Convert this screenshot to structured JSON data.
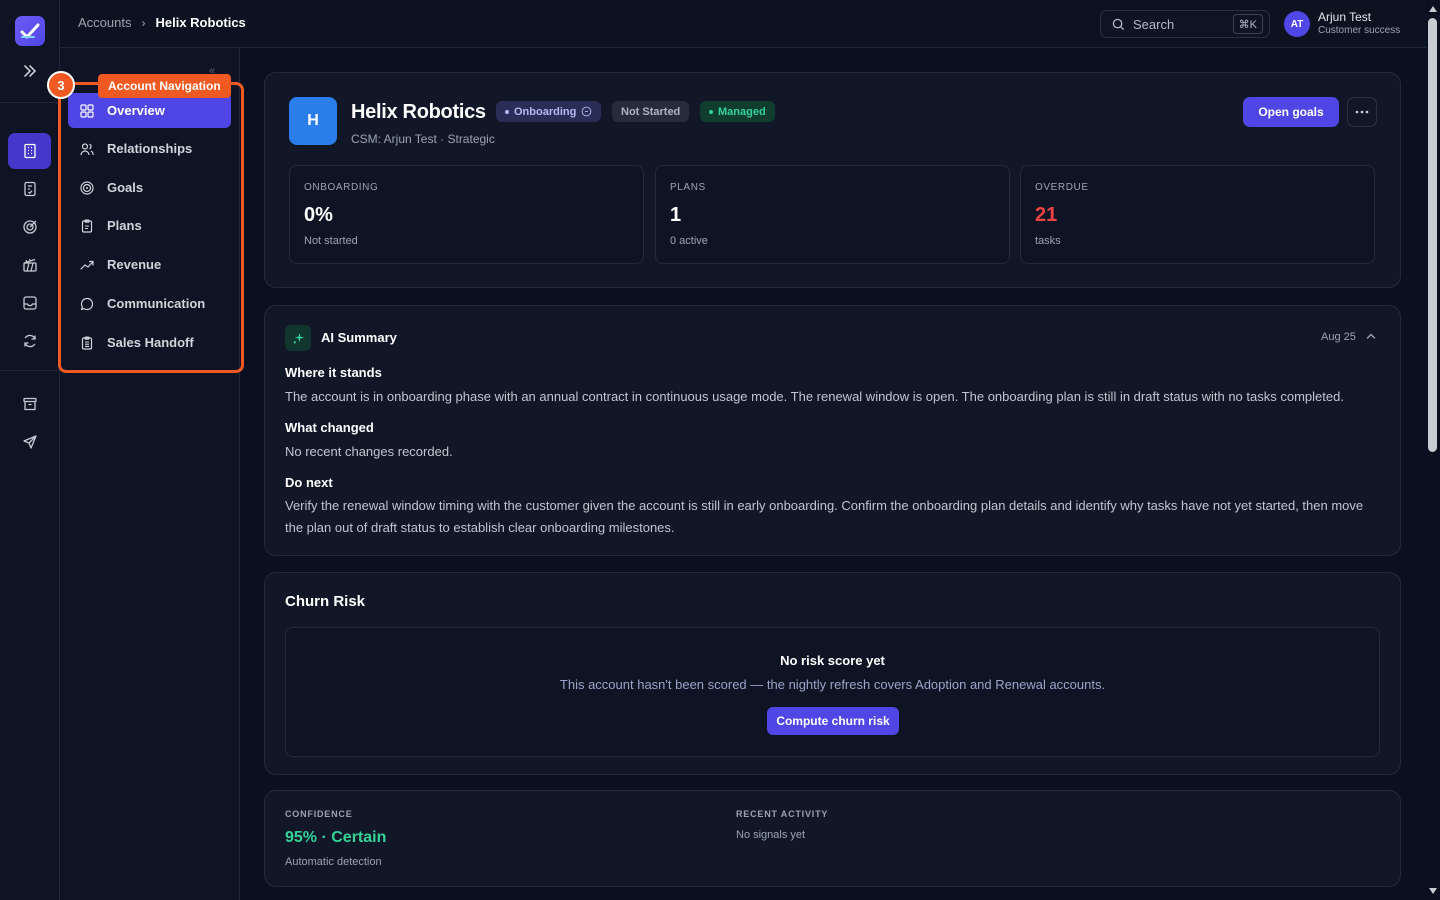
{
  "breadcrumb": {
    "parent": "Accounts",
    "current": "Helix Robotics"
  },
  "search": {
    "label": "Search",
    "shortcut": "⌘K"
  },
  "user": {
    "initials": "AT",
    "name": "Arjun Test",
    "role": "Customer success"
  },
  "tour": {
    "step": "3",
    "label": "Account Navigation"
  },
  "account_nav": [
    {
      "label": "Overview",
      "icon": "grid-icon",
      "active": true
    },
    {
      "label": "Relationships",
      "icon": "users-icon"
    },
    {
      "label": "Goals",
      "icon": "target-icon"
    },
    {
      "label": "Plans",
      "icon": "clipboard-icon"
    },
    {
      "label": "Revenue",
      "icon": "trend-icon"
    },
    {
      "label": "Communication",
      "icon": "chat-icon"
    },
    {
      "label": "Sales Handoff",
      "icon": "clipboard-list-icon"
    }
  ],
  "account": {
    "initial": "H",
    "name": "Helix Robotics",
    "status_onboarding": "Onboarding",
    "status_progress": "Not Started",
    "status_managed": "Managed",
    "subtitle": "CSM: Arjun Test · Strategic",
    "open_goals": "Open goals"
  },
  "stats": [
    {
      "label": "ONBOARDING",
      "value": "0%",
      "sub": "Not started"
    },
    {
      "label": "PLANS",
      "value": "1",
      "sub": "0 active"
    },
    {
      "label": "OVERDUE",
      "value": "21",
      "sub": "tasks"
    }
  ],
  "ai_summary": {
    "title": "AI Summary",
    "date": "Aug 25",
    "sections": [
      {
        "heading": "Where it stands",
        "text": "The account is in onboarding phase with an annual contract in continuous usage mode. The renewal window is open. The onboarding plan is still in draft status with no tasks completed."
      },
      {
        "heading": "What changed",
        "text": "No recent changes recorded."
      },
      {
        "heading": "Do next",
        "text": "Verify the renewal window timing with the customer given the account is still in early onboarding. Confirm the onboarding plan details and identify why tasks have not yet started, then move the plan out of draft status to establish clear onboarding milestones."
      }
    ]
  },
  "churn": {
    "title": "Churn Risk",
    "empty_heading": "No risk score yet",
    "empty_text": "This account hasn't been scored — the nightly refresh covers Adoption and Renewal accounts.",
    "button": "Compute churn risk"
  },
  "confidence": {
    "label": "CONFIDENCE",
    "value": "95% · Certain",
    "sub": "Automatic detection",
    "recent_label": "RECENT ACTIVITY",
    "recent_value": "No signals yet"
  },
  "colors": {
    "accent": "#4f46e5",
    "tour": "#f05a22",
    "success": "#34d399",
    "danger": "#ef4444"
  }
}
